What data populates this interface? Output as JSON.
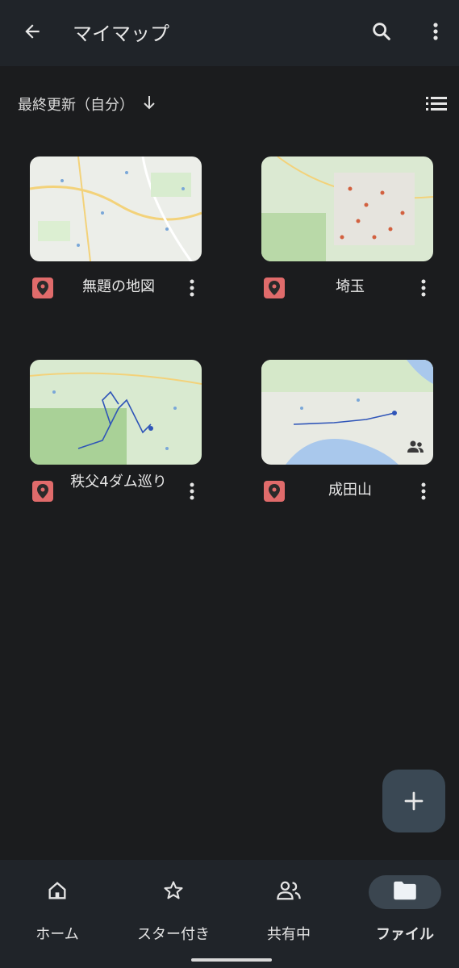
{
  "header": {
    "title": "マイマップ"
  },
  "sort": {
    "label": "最終更新（自分）"
  },
  "maps": [
    {
      "name": "無題の地図"
    },
    {
      "name": "埼玉"
    },
    {
      "name": "秩父4ダム巡り"
    },
    {
      "name": "成田山"
    }
  ],
  "nav": [
    {
      "label": "ホーム",
      "icon": "home-icon"
    },
    {
      "label": "スター付き",
      "icon": "star-icon"
    },
    {
      "label": "共有中",
      "icon": "people-icon"
    },
    {
      "label": "ファイル",
      "icon": "folder-icon"
    }
  ],
  "colors": {
    "background": "#1b1c1e",
    "bar": "#202429",
    "pin": "#e06b6b",
    "fab": "#3a4854"
  }
}
